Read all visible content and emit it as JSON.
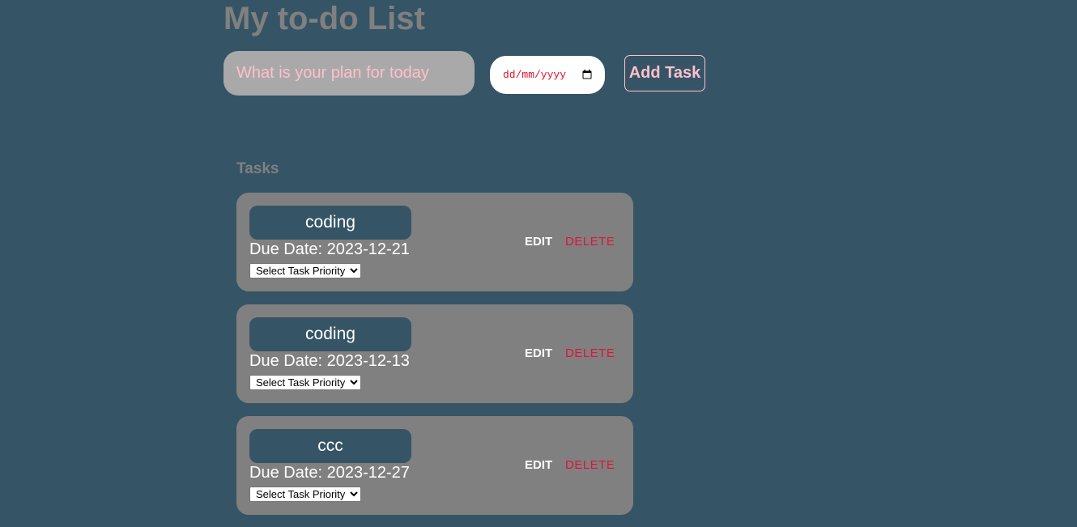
{
  "header": {
    "title": "My to-do List"
  },
  "form": {
    "task_placeholder": "What is your plan for today",
    "date_placeholder": "dd/mm/yyyy",
    "add_label": "Add Task"
  },
  "tasks_heading": "Tasks",
  "tasks": [
    {
      "name": "coding",
      "due_text": "Due Date: 2023-12-21",
      "priority": "Select Task Priority",
      "edit_label": "EDIT",
      "delete_label": "DELETE"
    },
    {
      "name": "coding",
      "due_text": "Due Date: 2023-12-13",
      "priority": "Select Task Priority",
      "edit_label": "EDIT",
      "delete_label": "DELETE"
    },
    {
      "name": "ccc",
      "due_text": "Due Date: 2023-12-27",
      "priority": "Select Task Priority",
      "edit_label": "EDIT",
      "delete_label": "DELETE"
    }
  ],
  "colors": {
    "background": "#355566",
    "card": "#808080",
    "accent_pink": "#ffc0cb",
    "delete_red": "#dc143c"
  },
  "icons": {
    "date_picker": "calendar-icon"
  }
}
